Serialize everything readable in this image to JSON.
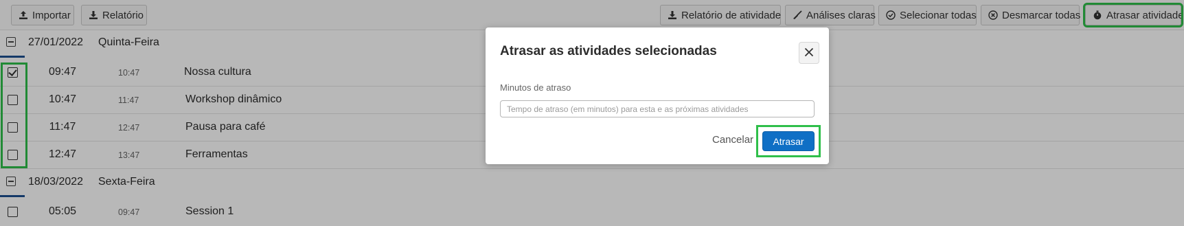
{
  "toolbar": {
    "left": [
      {
        "label": "Importar",
        "icon": "upload-icon"
      },
      {
        "label": "Relatório",
        "icon": "download-icon"
      }
    ],
    "right": [
      {
        "label": "Relatório de atividade",
        "icon": "download-icon"
      },
      {
        "label": "Análises claras",
        "icon": "broom-icon"
      },
      {
        "label": "Selecionar todas",
        "icon": "check-circle-icon"
      },
      {
        "label": "Desmarcar todas",
        "icon": "x-circle-icon"
      },
      {
        "label": "Atrasar atividade",
        "icon": "stopwatch-icon"
      }
    ]
  },
  "groups": [
    {
      "date": "27/01/2022",
      "weekday": "Quinta-Feira",
      "rows": [
        {
          "start": "09:47",
          "end": "10:47",
          "title": "Nossa cultura",
          "checked": true
        },
        {
          "start": "10:47",
          "end": "11:47",
          "title": "Workshop dinâmico",
          "checked": false
        },
        {
          "start": "11:47",
          "end": "12:47",
          "title": "Pausa para café",
          "checked": false
        },
        {
          "start": "12:47",
          "end": "13:47",
          "title": "Ferramentas",
          "checked": false
        }
      ]
    },
    {
      "date": "18/03/2022",
      "weekday": "Sexta-Feira",
      "rows": [
        {
          "start": "05:05",
          "end": "09:47",
          "title": "Session 1",
          "checked": false
        }
      ]
    }
  ],
  "modal": {
    "title": "Atrasar as atividades selecionadas",
    "field_label": "Minutos de atraso",
    "field_placeholder": "Tempo de atraso (em minutos) para esta e as próximas atividades",
    "field_value": "",
    "cancel_label": "Cancelar",
    "submit_label": "Atrasar"
  },
  "colors": {
    "primary": "#0f6fc5",
    "highlight": "#2fbf4a",
    "group_bar": "#1d4f91"
  }
}
